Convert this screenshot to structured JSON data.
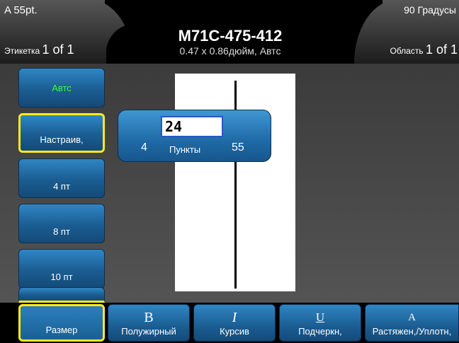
{
  "header": {
    "font_size": "A 55pt.",
    "rotation": "90 Градусы",
    "label_text": "Этикетка",
    "label_count": "1 of 1",
    "area_text": "Область",
    "area_count": "1 of 1",
    "part_number": "M71C-475-412",
    "label_dimensions": "0.47 x 0.86дюйм,  Автс"
  },
  "size_options": [
    "Автс",
    "Настраив,",
    "4 пт",
    "8 пт",
    "10 пт"
  ],
  "size_popup": {
    "value": "24",
    "min": "4",
    "unit": "Пункты",
    "max": "55"
  },
  "toolbar": {
    "size_label": "Размер",
    "bold_glyph": "B",
    "bold_label": "Полужирный",
    "italic_glyph": "I",
    "italic_label": "Курсив",
    "underline_glyph": "U",
    "underline_label": "Подчеркн,",
    "width_glyph": "A",
    "width_label": "Растяжен,/Уплотн,"
  },
  "colors": {
    "button_blue": "#1b5d92",
    "selection_yellow": "#ffeb1a",
    "auto_green": "#39ff39"
  }
}
